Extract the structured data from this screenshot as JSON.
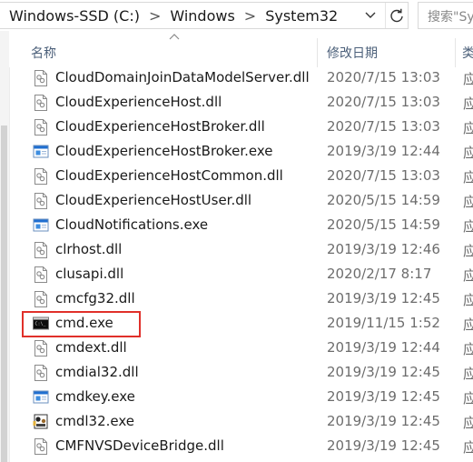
{
  "address_bar": {
    "crumbs": [
      "Windows-SSD (C:)",
      "Windows",
      "System32"
    ],
    "separator": ">",
    "dropdown_icon": "chevron-down-icon",
    "refresh_icon": "refresh-icon"
  },
  "search": {
    "placeholder": "搜索\"Sy"
  },
  "columns": {
    "name": "名称",
    "date": "修改日期",
    "type": "类"
  },
  "files": [
    {
      "name": "CloudDomainJoinDataModelServer.dll",
      "date": "2020/7/15 13:03",
      "type": "应",
      "icon": "dll-file-icon"
    },
    {
      "name": "CloudExperienceHost.dll",
      "date": "2020/7/15 13:03",
      "type": "应",
      "icon": "dll-file-icon"
    },
    {
      "name": "CloudExperienceHostBroker.dll",
      "date": "2020/7/15 13:03",
      "type": "应",
      "icon": "dll-file-icon"
    },
    {
      "name": "CloudExperienceHostBroker.exe",
      "date": "2019/3/19 12:44",
      "type": "应",
      "icon": "exe-window-icon"
    },
    {
      "name": "CloudExperienceHostCommon.dll",
      "date": "2020/7/15 13:03",
      "type": "应",
      "icon": "dll-file-icon"
    },
    {
      "name": "CloudExperienceHostUser.dll",
      "date": "2020/5/15 14:59",
      "type": "应",
      "icon": "dll-file-icon"
    },
    {
      "name": "CloudNotifications.exe",
      "date": "2020/5/15 14:59",
      "type": "应",
      "icon": "exe-window-icon"
    },
    {
      "name": "clrhost.dll",
      "date": "2019/3/19 12:46",
      "type": "应",
      "icon": "dll-file-icon"
    },
    {
      "name": "clusapi.dll",
      "date": "2020/2/17 8:17",
      "type": "应",
      "icon": "dll-file-icon"
    },
    {
      "name": "cmcfg32.dll",
      "date": "2019/3/19 12:45",
      "type": "应",
      "icon": "dll-file-icon"
    },
    {
      "name": "cmd.exe",
      "date": "2019/11/15 1:52",
      "type": "应",
      "icon": "console-icon"
    },
    {
      "name": "cmdext.dll",
      "date": "2019/3/19 12:44",
      "type": "应",
      "icon": "dll-file-icon"
    },
    {
      "name": "cmdial32.dll",
      "date": "2019/3/19 12:45",
      "type": "应",
      "icon": "dll-file-icon"
    },
    {
      "name": "cmdkey.exe",
      "date": "2019/3/19 12:45",
      "type": "应",
      "icon": "exe-window-icon"
    },
    {
      "name": "cmdl32.exe",
      "date": "2019/3/19 12:45",
      "type": "应",
      "icon": "cmdl-app-icon"
    },
    {
      "name": "CMFNVSDeviceBridge.dll",
      "date": "2019/3/19 12:45",
      "type": "应",
      "icon": "dll-file-icon"
    }
  ],
  "highlighted_file": "cmd.exe",
  "colors": {
    "highlight_border": "#e0302a",
    "header_text": "#4c607a",
    "exe_icon_blue": "#1f6fd1"
  }
}
